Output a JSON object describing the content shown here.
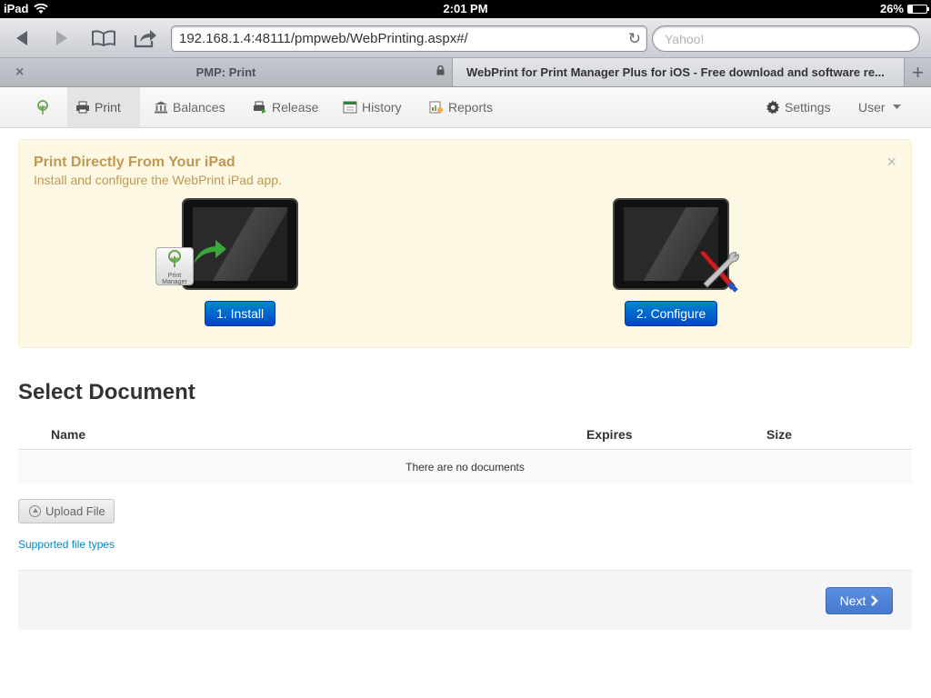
{
  "statusbar": {
    "device": "iPad",
    "time": "2:01 PM",
    "battery": "26%",
    "battery_level": 0.26
  },
  "browser": {
    "url": "192.168.1.4:48111/pmpweb/WebPrinting.aspx#/",
    "search_placeholder": "Yahoo!",
    "tabs": [
      {
        "title": "PMP: Print",
        "close": "×"
      },
      {
        "title": "WebPrint for Print Manager Plus for iOS - Free download and software re..."
      }
    ],
    "add_tab": "+"
  },
  "nav": {
    "items": [
      {
        "label": "Print",
        "icon": "printer-icon"
      },
      {
        "label": "Balances",
        "icon": "bank-icon"
      },
      {
        "label": "Release",
        "icon": "release-icon"
      },
      {
        "label": "History",
        "icon": "calendar-icon"
      },
      {
        "label": "Reports",
        "icon": "report-icon"
      }
    ],
    "settings": "Settings",
    "user": "User"
  },
  "alert": {
    "title": "Print Directly From Your iPad",
    "subtitle": "Install and configure the WebPrint iPad app.",
    "close": "×",
    "install_button": "1. Install",
    "configure_button": "2. Configure",
    "badge_text": "Print Manager"
  },
  "documents": {
    "title": "Select Document",
    "columns": [
      "Name",
      "Expires",
      "Size"
    ],
    "empty_message": "There are no documents",
    "upload_button": "Upload File",
    "supported_link": "Supported file types",
    "next_button": "Next"
  },
  "colors": {
    "accent": "#0088cc",
    "alert_bg": "#fcf8e3",
    "alert_text": "#c09853",
    "next_btn": "#4e82d6"
  }
}
